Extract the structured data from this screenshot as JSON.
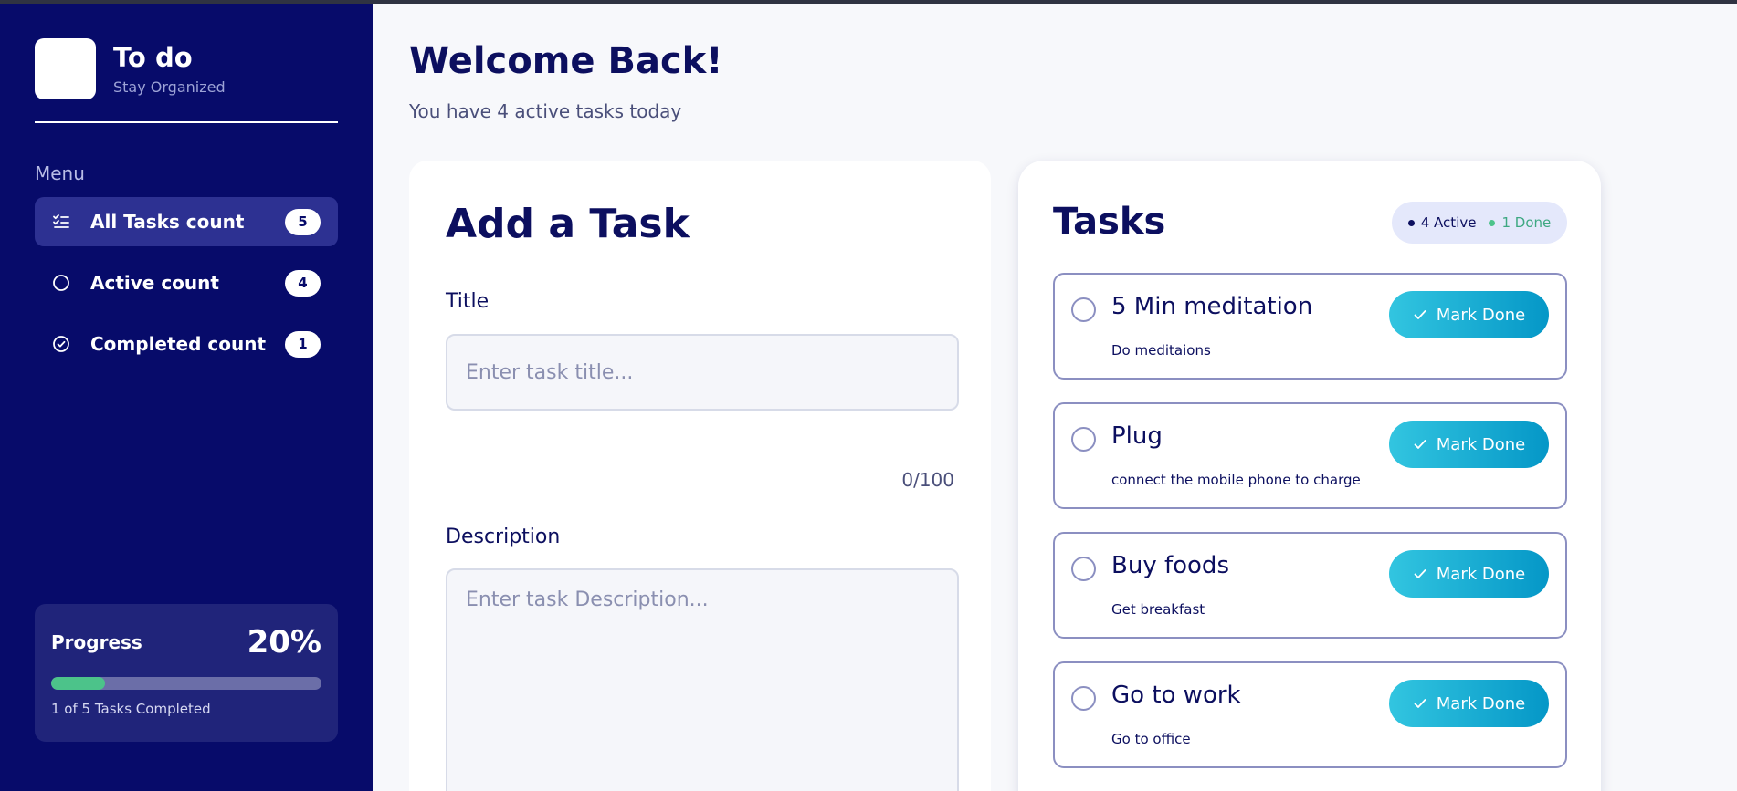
{
  "brand": {
    "title": "To do",
    "subtitle": "Stay Organized"
  },
  "sidebar": {
    "menu_label": "Menu",
    "items": [
      {
        "label": "All Tasks count",
        "count": "5",
        "icon": "checklist-icon",
        "active": true
      },
      {
        "label": "Active count",
        "count": "4",
        "icon": "circle-icon",
        "active": false
      },
      {
        "label": "Completed count",
        "count": "1",
        "icon": "check-circle-icon",
        "active": false
      }
    ],
    "progress": {
      "title": "Progress",
      "percent_label": "20%",
      "fraction": 0.2,
      "summary": "1 of 5 Tasks Completed"
    }
  },
  "header": {
    "title": "Welcome Back!",
    "subtitle": "You have 4 active tasks today"
  },
  "add_task": {
    "title": "Add a Task",
    "title_label": "Title",
    "title_placeholder": "Enter task title...",
    "char_count": "0/100",
    "description_label": "Description",
    "description_placeholder": "Enter task Description..."
  },
  "tasks": {
    "title": "Tasks",
    "active_label": "4 Active",
    "done_label": "1 Done",
    "mark_done_label": "Mark Done",
    "items": [
      {
        "title": "5 Min meditation",
        "description": "Do meditaions"
      },
      {
        "title": "Plug",
        "description": "connect the mobile phone to charge"
      },
      {
        "title": "Buy foods",
        "description": "Get breakfast"
      },
      {
        "title": "Go to work",
        "description": "Go to office"
      }
    ]
  },
  "colors": {
    "sidebar_bg": "#070b6a",
    "accent_green": "#4cc38a",
    "button_gradient_start": "#32c5e0",
    "button_gradient_end": "#0597c7",
    "text_primary": "#0c0f5f"
  }
}
